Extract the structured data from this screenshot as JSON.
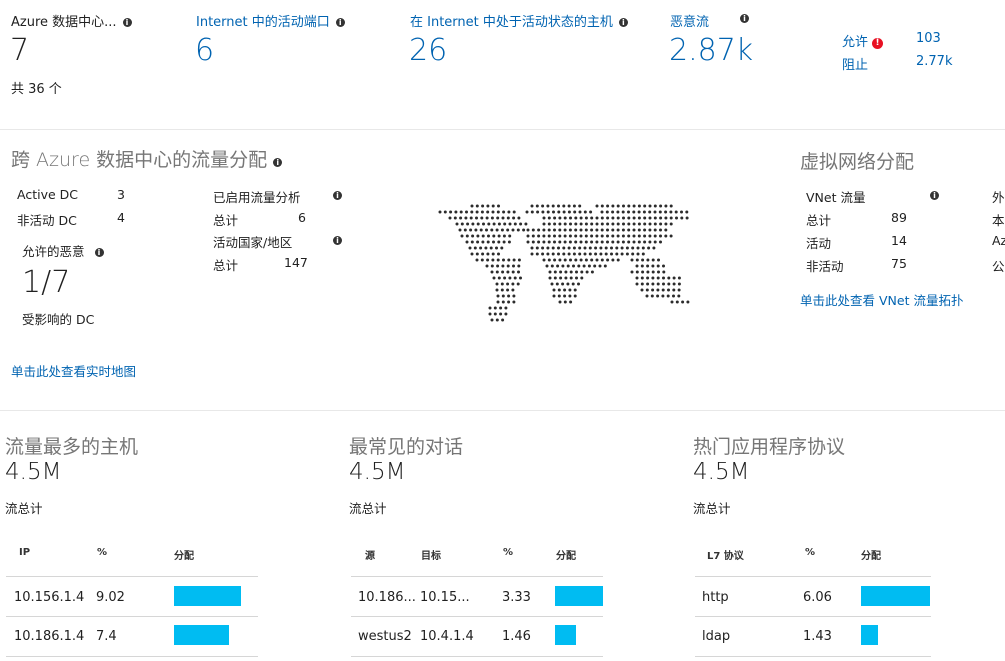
{
  "summary": {
    "dc": {
      "label": "Azure 数据中心...",
      "value": "7",
      "sub": "共 36 个"
    },
    "ports": {
      "label": "Internet 中的活动端口",
      "value": "6"
    },
    "hosts": {
      "label": "在 Internet 中处于活动状态的主机",
      "value": "26"
    },
    "malicious": {
      "label": "恶意流",
      "value": "2.87k"
    },
    "allow": {
      "label": "允许",
      "value": "103"
    },
    "block": {
      "label": "阻止",
      "value": "2.77k"
    }
  },
  "distribution": {
    "title": "跨 Azure 数据中心的流量分配",
    "active_dc_label": "Active DC",
    "active_dc_value": "3",
    "inactive_dc_label": "非活动 DC",
    "inactive_dc_value": "4",
    "allowed_malicious_label": "允许的恶意",
    "affected_value": "1/7",
    "affected_label": "受影响的 DC",
    "flow_analytics_label": "已启用流量分析",
    "total_label": "总计",
    "total_value": "6",
    "countries_label": "活动国家/地区",
    "countries_total_label": "总计",
    "countries_total_value": "147",
    "map_link": "单击此处查看实时地图"
  },
  "vnet": {
    "title": "虚拟网络分配",
    "flow_label": "VNet 流量",
    "total_label": "总计",
    "total_value": "89",
    "active_label": "活动",
    "active_value": "14",
    "inactive_label": "非活动",
    "inactive_value": "75",
    "link": "单击此处查看 VNet 流量拓扑",
    "clipped": [
      "外",
      "本",
      "Az",
      "公"
    ]
  },
  "top_hosts": {
    "title": "流量最多的主机",
    "value": "4.5M",
    "sub": "流总计",
    "headers": [
      "IP",
      "%",
      "分配"
    ],
    "rows": [
      {
        "ip": "10.156.1.4",
        "pct": "9.02",
        "frac": 0.8
      },
      {
        "ip": "10.186.1.4",
        "pct": "7.4",
        "frac": 0.66
      }
    ]
  },
  "conversations": {
    "title": "最常见的对话",
    "value": "4.5M",
    "sub": "流总计",
    "headers": [
      "源",
      "目标",
      "%",
      "分配"
    ],
    "rows": [
      {
        "src": "10.186...",
        "dst": "10.15...",
        "pct": "3.33",
        "frac": 1.0
      },
      {
        "src": "westus2",
        "dst": "10.4.1.4",
        "pct": "1.46",
        "frac": 0.44
      }
    ]
  },
  "protocols": {
    "title": "热门应用程序协议",
    "value": "4.5M",
    "sub": "流总计",
    "headers": [
      "L7 协议",
      "%",
      "分配"
    ],
    "rows": [
      {
        "proto": "http",
        "pct": "6.06",
        "frac": 1.0
      },
      {
        "proto": "ldap",
        "pct": "1.43",
        "frac": 0.24
      }
    ]
  },
  "colors": {
    "accent": "#0063b1",
    "bar": "#00bcf2",
    "error": "#e81123"
  }
}
